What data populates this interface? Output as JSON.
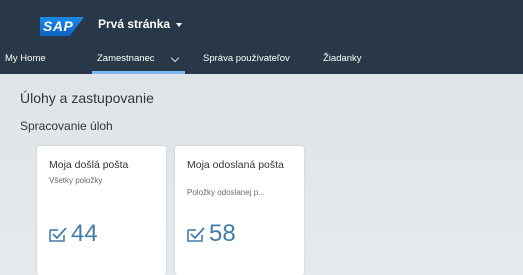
{
  "shell": {
    "logo_text": "SAP",
    "app_title": "Prvá stránka"
  },
  "nav": {
    "items": [
      {
        "label": "My Home"
      },
      {
        "label": "Zamestnanec"
      },
      {
        "label": "Správa používateľov"
      },
      {
        "label": "Žiadanky"
      }
    ]
  },
  "content": {
    "section_title": "Úlohy a zastupovanie",
    "group_title": "Spracovanie úloh",
    "tiles": [
      {
        "title": "Moja došlá pošta",
        "subtitle": "Všetky položky",
        "count": "44"
      },
      {
        "title": "Moja odoslaná pošta",
        "subtitle": "Položky odoslanej p...",
        "count": "58"
      }
    ]
  },
  "colors": {
    "shell": "#283848",
    "accent": "#427cac",
    "content_bg": "#dfe4e8"
  }
}
